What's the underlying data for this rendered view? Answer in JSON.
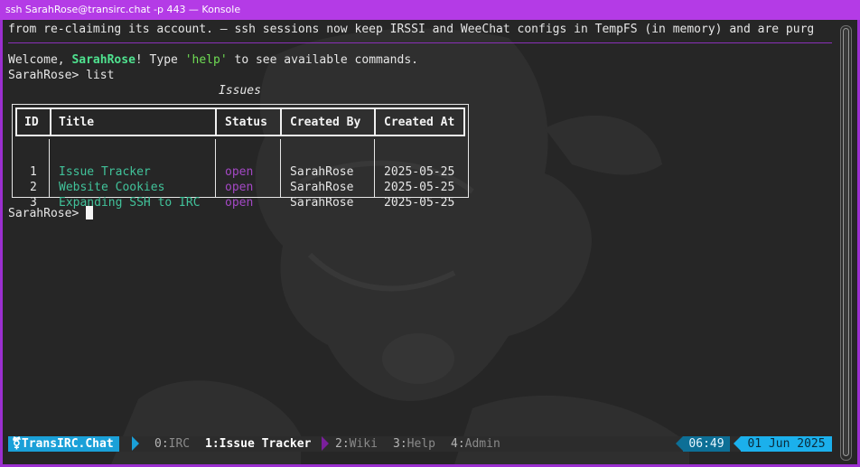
{
  "window": {
    "title": "ssh SarahRose@transirc.chat -p 443 — Konsole"
  },
  "terminal": {
    "motd": "from re-claiming its account. — ssh sessions now keep IRSSI and WeeChat configs in TempFS (in memory) and are purg",
    "welcome_prefix": "Welcome, ",
    "welcome_user": "SarahRose",
    "welcome_mid": "! Type ",
    "welcome_cmd": "'help'",
    "welcome_suffix": " to see available commands.",
    "prompt": "SarahRose> ",
    "command": "list",
    "table_caption": "Issues",
    "columns": [
      "ID",
      "Title",
      "Status",
      "Created By",
      "Created At"
    ],
    "rows": [
      {
        "id": "1",
        "title": "Issue Tracker",
        "status": "open",
        "created_by": "SarahRose",
        "created_at": "2025-05-25"
      },
      {
        "id": "2",
        "title": "Website Cookies",
        "status": "open",
        "created_by": "SarahRose",
        "created_at": "2025-05-25"
      },
      {
        "id": "3",
        "title": "Expanding SSH to IRC",
        "status": "open",
        "created_by": "SarahRose",
        "created_at": "2025-05-25"
      }
    ],
    "prompt2": "SarahRose> "
  },
  "statusbar": {
    "session_icon": "transgender-symbol-icon",
    "session_glyph": "⚧",
    "session_name": "TransIRC.Chat",
    "windows": [
      {
        "num": "0:",
        "name": "IRC"
      },
      {
        "num": "1:",
        "name": "Issue Tracker"
      },
      {
        "num": "2:",
        "name": "Wiki"
      },
      {
        "num": "3:",
        "name": "Help"
      },
      {
        "num": "4:",
        "name": "Admin"
      }
    ],
    "time": "06:49",
    "date": "01 Jun 2025"
  },
  "colors": {
    "frame": "#9b2fd0",
    "background": "#262626",
    "accent_blue": "#1aa0d8",
    "title_green": "#41c29a",
    "status_purple": "#a348c4"
  }
}
